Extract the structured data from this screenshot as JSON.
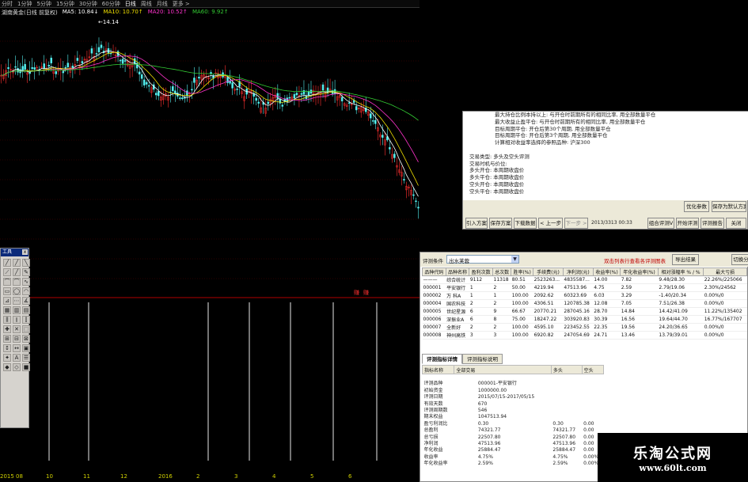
{
  "topbar": {
    "periods": [
      "分时",
      "1分钟",
      "5分钟",
      "15分钟",
      "30分钟",
      "60分钟",
      "日线",
      "周线",
      "月线",
      "更多 >"
    ],
    "active_index": 6
  },
  "ma_line": {
    "stock": "湖南黄金(日线 前复权)",
    "items": [
      {
        "label": "MA5: 10.84↓",
        "color": "#ffffff"
      },
      {
        "label": "MA10: 10.70↑",
        "color": "#f0e000"
      },
      {
        "label": "MA20: 10.52↑",
        "color": "#ff33cc"
      },
      {
        "label": "MA60: 9.92↑",
        "color": "#33cc33"
      }
    ]
  },
  "chart": {
    "peak_label": "14.14",
    "signal_labels": [
      "赚",
      "赚"
    ]
  },
  "x_axis": [
    "2015 08",
    "10",
    "11",
    "12",
    "2016",
    "2",
    "3",
    "4",
    "5",
    "6"
  ],
  "tool_palette": {
    "title": "工具",
    "close": "x"
  },
  "description": {
    "lines": [
      "最大持仓比例本持以上: 与开仓时前期所有的相同比率, 用全部数量平仓",
      "最大收益止盈平仓: 与开仓时前期所有的相同比率, 用全部数量平仓",
      "目标周期平仓: 开仓后第30个周期, 用全部数量平仓",
      "目标周期平仓: 开仓后第3个周期, 用全部数量平仓",
      "计算相对收益率选择的参照品种: 沪深300",
      "",
      "交易类型: 多头及空头评测",
      "交易时机与价位:",
      "    多头开仓: 本周期收盘价",
      "    多头平仓: 本周期收盘价",
      "    空头开仓: 本周期收盘价",
      "    空头平仓: 本周期收盘价"
    ],
    "buttons_top": [
      "优化参数",
      "保存为默认方案"
    ],
    "buttons_bottom": [
      "引入方案",
      "保存方案",
      "下载数据",
      "< 上一步",
      "下一步 >"
    ],
    "timestamp": "2013/3313 00:33",
    "buttons_right": [
      "组合评测V",
      "开始评测",
      "评测报告",
      "关闭"
    ]
  },
  "evaluation": {
    "condition_label": "评测条件",
    "condition_value": "出水芙蓉",
    "note": "双击列表行查看各评测图表",
    "export_label": "导出结果",
    "switch_label": "切换分",
    "columns": [
      "品种代码",
      "品种名称",
      "盈利次数",
      "总次数",
      "胜率(%)",
      "手续费(元)",
      "净利润(元)",
      "收益率(%)",
      "年化收益率(%)",
      "相对涨幅率 % / %",
      "最大亏损"
    ],
    "rows": [
      [
        "———",
        "综合统计",
        "9112",
        "11318",
        "80.51",
        "2523263...",
        "4835587...",
        "14.00",
        "7.82",
        "9.48/28.30",
        "22.26%/225066"
      ],
      [
        "000001",
        "平安银行",
        "1",
        "2",
        "50.00",
        "4219.94",
        "47513.96",
        "4.75",
        "2.59",
        "2.79/19.06",
        "2.30%/24562"
      ],
      [
        "000002",
        "万 科A",
        "1",
        "1",
        "100.00",
        "2092.62",
        "60323.69",
        "6.03",
        "3.29",
        "-1.40/20.34",
        "0.00%/0"
      ],
      [
        "000004",
        "国农科技",
        "2",
        "2",
        "100.00",
        "4306.51",
        "120785.38",
        "12.08",
        "7.05",
        "7.51/26.38",
        "0.00%/0"
      ],
      [
        "000005",
        "世纪星源",
        "6",
        "9",
        "66.67",
        "20770.21",
        "287045.16",
        "28.70",
        "14.84",
        "14.42/41.09",
        "11.22%/135402"
      ],
      [
        "000006",
        "深振业A",
        "6",
        "8",
        "75.00",
        "18247.22",
        "303920.83",
        "30.39",
        "16.56",
        "19.64/44.70",
        "16.77%/167707"
      ],
      [
        "000007",
        "全新好",
        "2",
        "2",
        "100.00",
        "4595.10",
        "223452.55",
        "22.35",
        "19.56",
        "24.20/36.65",
        "0.00%/0"
      ],
      [
        "000008",
        "神州高铁",
        "3",
        "3",
        "100.00",
        "6920.82",
        "247054.69",
        "24.71",
        "13.46",
        "13.79/39.01",
        "0.00%/0"
      ]
    ],
    "tabs": [
      "评测指标详情",
      "评测指标说明"
    ],
    "detail_header": [
      "指标名称",
      "全部交易",
      "多头",
      "空头"
    ],
    "detail_rows": [
      [
        "",
        "",
        "",
        ""
      ],
      [
        "评测品种",
        "000001-平安银行",
        "",
        ""
      ],
      [
        "初始资金",
        "1000000.00",
        "",
        ""
      ],
      [
        "评测日期",
        "2015/07/15-2017/05/15",
        "",
        ""
      ],
      [
        "有效天数",
        "670",
        "",
        ""
      ],
      [
        "评测周期数",
        "546",
        "",
        ""
      ],
      [
        "期末权益",
        "1047513.94",
        "",
        ""
      ],
      [
        "盈亏利润比",
        "0.30",
        "0.30",
        "0.00"
      ],
      [
        "总盈利",
        "74321.77",
        "74321.77",
        "0.00"
      ],
      [
        "总亏损",
        "22507.80",
        "22507.80",
        "0.00"
      ],
      [
        "净利润",
        "47513.96",
        "47513.96",
        "0.00"
      ],
      [
        "年化收益",
        "25884.47",
        "25884.47",
        "0.00"
      ],
      [
        "收益率",
        "4.75%",
        "4.75%",
        "0.00%"
      ],
      [
        "年化收益率",
        "2.59%",
        "2.59%",
        "0.00%"
      ]
    ]
  },
  "watermark": {
    "title": "乐淘公式网",
    "url": "www.60lt.com"
  }
}
